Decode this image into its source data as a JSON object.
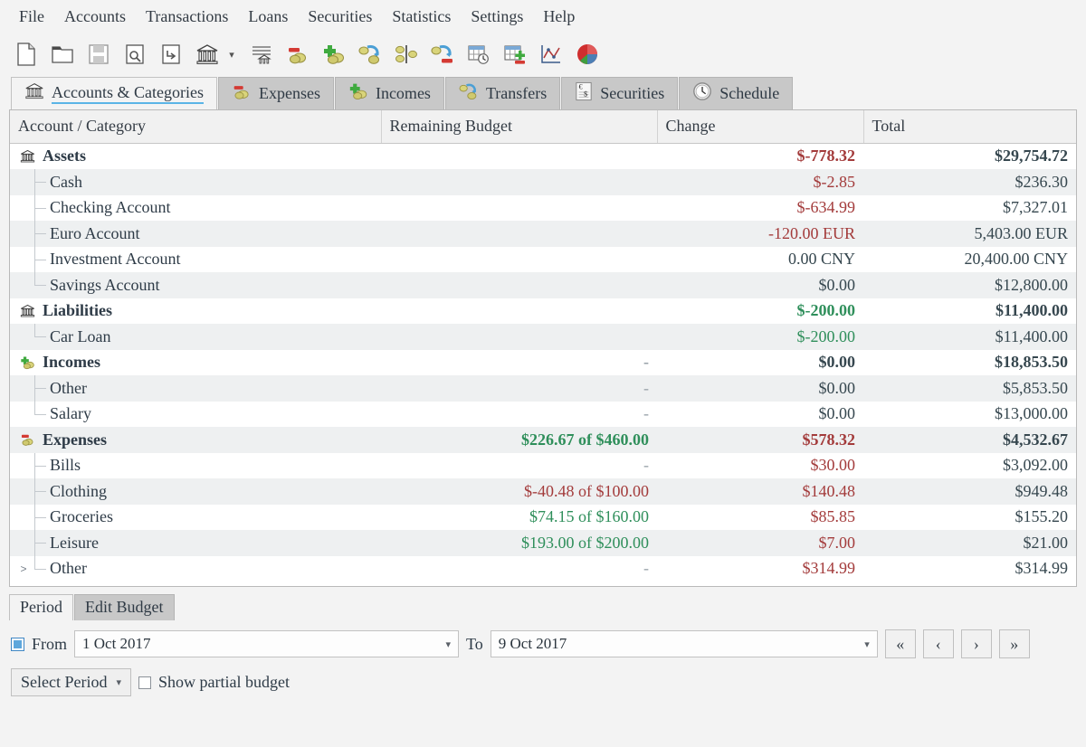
{
  "menu": {
    "items": [
      "File",
      "Accounts",
      "Transactions",
      "Loans",
      "Securities",
      "Statistics",
      "Settings",
      "Help"
    ]
  },
  "toolbar": {
    "items": [
      {
        "name": "new-file-icon",
        "title": "New"
      },
      {
        "name": "open-folder-icon",
        "title": "Open"
      },
      {
        "name": "save-icon",
        "title": "Save"
      },
      {
        "name": "print-preview-icon",
        "title": "Print Preview"
      },
      {
        "name": "export-icon",
        "title": "Export"
      },
      {
        "name": "account-bank-icon",
        "title": "Account"
      },
      {
        "name": "chevron-down-icon",
        "title": "More accounts"
      },
      {
        "name": "account-list-icon",
        "title": "Account list"
      },
      {
        "name": "expense-icon",
        "title": "New Expense"
      },
      {
        "name": "income-icon",
        "title": "New Income"
      },
      {
        "name": "transfer-icon",
        "title": "New Transfer"
      },
      {
        "name": "split-icon",
        "title": "Split"
      },
      {
        "name": "payment-icon",
        "title": "Payment"
      },
      {
        "name": "schedule-icon",
        "title": "Schedule"
      },
      {
        "name": "budget-icon",
        "title": "Budget"
      },
      {
        "name": "chart-line-icon",
        "title": "Charts"
      },
      {
        "name": "chart-pie-icon",
        "title": "Reports"
      }
    ]
  },
  "tabs": [
    {
      "label": "Accounts & Categories",
      "icon": "bank-icon",
      "active": true
    },
    {
      "label": "Expenses",
      "icon": "expense-icon",
      "active": false
    },
    {
      "label": "Incomes",
      "icon": "income-icon",
      "active": false
    },
    {
      "label": "Transfers",
      "icon": "transfer-icon",
      "active": false
    },
    {
      "label": "Securities",
      "icon": "securities-icon",
      "active": false
    },
    {
      "label": "Schedule",
      "icon": "clock-icon",
      "active": false
    }
  ],
  "table": {
    "columns": [
      "Account / Category",
      "Remaining Budget",
      "Change",
      "Total"
    ],
    "rows": [
      {
        "name": "Assets",
        "level": 0,
        "icon": "bank-icon",
        "bold": true,
        "expander": "",
        "budget": "",
        "budget_color": "none",
        "change": "$-778.32",
        "change_color": "neg",
        "total": "$29,754.72",
        "total_color": "pos"
      },
      {
        "name": "Cash",
        "level": 1,
        "icon": "",
        "bold": false,
        "expander": "",
        "last": false,
        "budget": "",
        "budget_color": "none",
        "change": "$-2.85",
        "change_color": "neg",
        "total": "$236.30",
        "total_color": "pos"
      },
      {
        "name": "Checking Account",
        "level": 1,
        "icon": "",
        "bold": false,
        "expander": "",
        "last": false,
        "budget": "",
        "budget_color": "none",
        "change": "$-634.99",
        "change_color": "neg",
        "total": "$7,327.01",
        "total_color": "pos"
      },
      {
        "name": "Euro Account",
        "level": 1,
        "icon": "",
        "bold": false,
        "expander": "",
        "last": false,
        "budget": "",
        "budget_color": "none",
        "change": "-120.00 EUR",
        "change_color": "neg",
        "total": "5,403.00 EUR",
        "total_color": "pos"
      },
      {
        "name": "Investment Account",
        "level": 1,
        "icon": "",
        "bold": false,
        "expander": "",
        "last": false,
        "budget": "",
        "budget_color": "none",
        "change": "0.00 CNY",
        "change_color": "pos",
        "total": "20,400.00 CNY",
        "total_color": "pos"
      },
      {
        "name": "Savings Account",
        "level": 1,
        "icon": "",
        "bold": false,
        "expander": "",
        "last": true,
        "budget": "",
        "budget_color": "none",
        "change": "$0.00",
        "change_color": "pos",
        "total": "$12,800.00",
        "total_color": "pos"
      },
      {
        "name": "Liabilities",
        "level": 0,
        "icon": "bank-icon",
        "bold": true,
        "expander": "",
        "budget": "",
        "budget_color": "none",
        "change": "$-200.00",
        "change_color": "grn",
        "total": "$11,400.00",
        "total_color": "pos"
      },
      {
        "name": "Car Loan",
        "level": 1,
        "icon": "",
        "bold": false,
        "expander": "",
        "last": true,
        "budget": "",
        "budget_color": "none",
        "change": "$-200.00",
        "change_color": "grn",
        "total": "$11,400.00",
        "total_color": "pos"
      },
      {
        "name": "Incomes",
        "level": 0,
        "icon": "income-icon",
        "bold": true,
        "expander": "",
        "budget": "-",
        "budget_color": "dash",
        "change": "$0.00",
        "change_color": "pos",
        "total": "$18,853.50",
        "total_color": "pos"
      },
      {
        "name": "Other",
        "level": 1,
        "icon": "",
        "bold": false,
        "expander": "",
        "last": false,
        "budget": "-",
        "budget_color": "dash",
        "change": "$0.00",
        "change_color": "pos",
        "total": "$5,853.50",
        "total_color": "pos"
      },
      {
        "name": "Salary",
        "level": 1,
        "icon": "",
        "bold": false,
        "expander": "",
        "last": true,
        "budget": "-",
        "budget_color": "dash",
        "change": "$0.00",
        "change_color": "pos",
        "total": "$13,000.00",
        "total_color": "pos"
      },
      {
        "name": "Expenses",
        "level": 0,
        "icon": "expense-icon",
        "bold": true,
        "expander": "",
        "budget": "$226.67 of $460.00",
        "budget_color": "grn",
        "change": "$578.32",
        "change_color": "neg",
        "total": "$4,532.67",
        "total_color": "pos"
      },
      {
        "name": "Bills",
        "level": 1,
        "icon": "",
        "bold": false,
        "expander": "",
        "last": false,
        "budget": "-",
        "budget_color": "dash",
        "change": "$30.00",
        "change_color": "neg",
        "total": "$3,092.00",
        "total_color": "pos"
      },
      {
        "name": "Clothing",
        "level": 1,
        "icon": "",
        "bold": false,
        "expander": "",
        "last": false,
        "budget": "$-40.48 of $100.00",
        "budget_color": "neg",
        "change": "$140.48",
        "change_color": "neg",
        "total": "$949.48",
        "total_color": "pos"
      },
      {
        "name": "Groceries",
        "level": 1,
        "icon": "",
        "bold": false,
        "expander": "",
        "last": false,
        "budget": "$74.15 of $160.00",
        "budget_color": "grn",
        "change": "$85.85",
        "change_color": "neg",
        "total": "$155.20",
        "total_color": "pos"
      },
      {
        "name": "Leisure",
        "level": 1,
        "icon": "",
        "bold": false,
        "expander": "",
        "last": false,
        "budget": "$193.00 of $200.00",
        "budget_color": "grn",
        "change": "$7.00",
        "change_color": "neg",
        "total": "$21.00",
        "total_color": "pos"
      },
      {
        "name": "Other",
        "level": 1,
        "icon": "",
        "bold": false,
        "expander": ">",
        "last": true,
        "budget": "-",
        "budget_color": "dash",
        "change": "$314.99",
        "change_color": "neg",
        "total": "$314.99",
        "total_color": "pos"
      }
    ]
  },
  "bottom": {
    "subtabs": [
      {
        "label": "Period",
        "active": true
      },
      {
        "label": "Edit Budget",
        "active": false
      }
    ],
    "from_label": "From",
    "from_value": "1 Oct 2017",
    "to_label": "To",
    "to_value": "9 Oct 2017",
    "nav": [
      {
        "name": "first-period-button",
        "glyph": "«"
      },
      {
        "name": "previous-period-button",
        "glyph": "‹"
      },
      {
        "name": "next-period-button",
        "glyph": "›"
      },
      {
        "name": "last-period-button",
        "glyph": "»"
      }
    ],
    "select_period_label": "Select Period",
    "show_partial_label": "Show partial budget",
    "caret": "∨"
  },
  "colors": {
    "negative": "#a33b3b",
    "positive": "#36474f",
    "green": "#2f8f5b",
    "accent": "#5ab4e6",
    "window_bg": "#f3f3f3"
  }
}
